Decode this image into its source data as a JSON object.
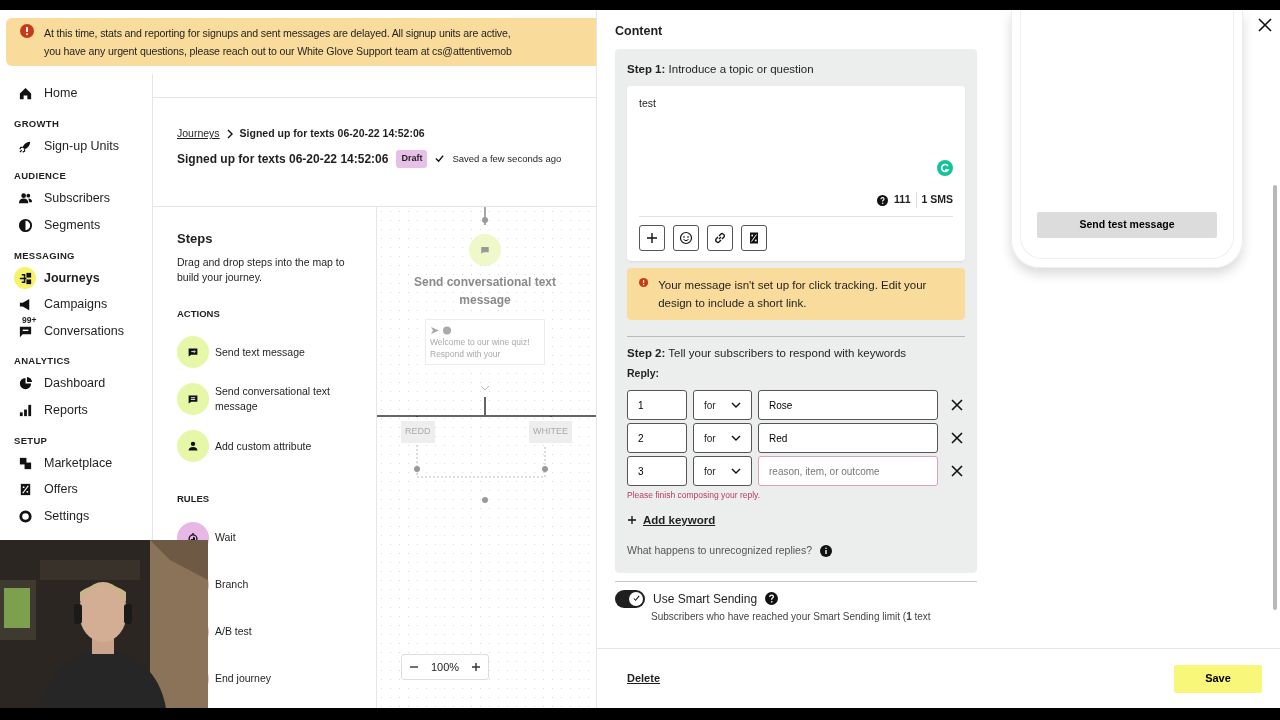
{
  "banner": {
    "lines": [
      "At this time, stats and reporting for signups and sent messages are delayed. All signup units are active,",
      "you have any urgent questions, please reach out to our White Glove Support team at cs@attentivemob"
    ]
  },
  "sidebar": {
    "sections": [
      {
        "items": [
          {
            "label": "Home",
            "selected": false
          }
        ]
      },
      {
        "heading": "GROWTH",
        "items": [
          {
            "label": "Sign-up Units",
            "selected": false
          }
        ]
      },
      {
        "heading": "AUDIENCE",
        "items": [
          {
            "label": "Subscribers",
            "selected": false
          },
          {
            "label": "Segments",
            "selected": false
          }
        ]
      },
      {
        "heading": "MESSAGING",
        "items": [
          {
            "label": "Journeys",
            "selected": true
          },
          {
            "label": "Campaigns",
            "selected": false
          },
          {
            "label": "Conversations",
            "selected": false,
            "badge": "99+"
          }
        ]
      },
      {
        "heading": "ANALYTICS",
        "items": [
          {
            "label": "Dashboard",
            "selected": false
          },
          {
            "label": "Reports",
            "selected": false
          }
        ]
      },
      {
        "heading": "SETUP",
        "items": [
          {
            "label": "Marketplace",
            "selected": false
          },
          {
            "label": "Offers",
            "selected": false
          },
          {
            "label": "Settings",
            "selected": false
          }
        ]
      }
    ]
  },
  "header": {
    "breadcrumb_link": "Journeys",
    "breadcrumb_current": "Signed up for texts 06-20-22 14:52:06",
    "title": "Signed up for texts 06-20-22 14:52:06",
    "status": "Draft",
    "saved": "Saved a few seconds ago"
  },
  "steps": {
    "title": "Steps",
    "description": "Drag and drop steps into the map to build your journey.",
    "groups": [
      {
        "heading": "ACTIONS",
        "kind": "action",
        "items": [
          "Send text message",
          "Send conversational text message",
          "Add custom attribute"
        ]
      },
      {
        "heading": "RULES",
        "kind": "rule",
        "items": [
          "Wait",
          "Branch",
          "A/B test",
          "End journey"
        ]
      }
    ]
  },
  "canvas": {
    "node_title": "Send conversational text message",
    "preview": "Welcome to our wine quiz! Respond with your",
    "branches": [
      "REDD",
      "WHITEE"
    ],
    "zoom": "100%"
  },
  "drawer": {
    "heading": "Content",
    "step1": {
      "title": "**Step 1:** Introduce a topic or question",
      "message": "test",
      "char_count": "111",
      "segments": "1 SMS"
    },
    "warning": "Your message isn't set up for click tracking. Edit your design to include a short link.",
    "step2": {
      "title": "**Step 2:** Tell your subscribers to respond with keywords",
      "reply_label": "Reply:",
      "keywords": [
        {
          "key": "1",
          "connector": "for",
          "value": "Rose"
        },
        {
          "key": "2",
          "connector": "for",
          "value": "Red"
        },
        {
          "key": "3",
          "connector": "for",
          "placeholder": "reason, item, or outcome",
          "error": "Please finish composing your reply."
        }
      ],
      "add_keyword": "Add keyword",
      "unrecognized": "What happens to unrecognized replies?"
    },
    "smart_sending": {
      "label": "Use Smart Sending",
      "on": true,
      "description": "Subscribers who have reached your Smart Sending limit (**1** text"
    },
    "preview_button": "Send test message",
    "footer": {
      "delete": "Delete",
      "save": "Save"
    }
  }
}
